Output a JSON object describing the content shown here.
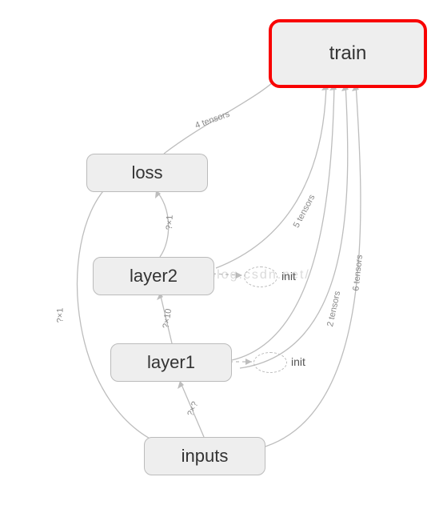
{
  "nodes": {
    "train": {
      "label": "train"
    },
    "loss": {
      "label": "loss"
    },
    "layer2": {
      "label": "layer2"
    },
    "layer1": {
      "label": "layer1"
    },
    "inputs": {
      "label": "inputs"
    },
    "init1": {
      "label": "init"
    },
    "init2": {
      "label": "init"
    }
  },
  "edge_labels": {
    "loss_to_train": "4 tensors",
    "layer2_to_train": "5 tensors",
    "layer1_to_train_a": "2 tensors",
    "layer1_to_train_b": "6 tensors",
    "layer2_to_loss": "?×1",
    "layer1_to_layer2": "?×10",
    "inputs_to_layer1": "?×?",
    "inputs_to_loss": "?×1"
  },
  "watermark": "p://blog.csdn.net/"
}
